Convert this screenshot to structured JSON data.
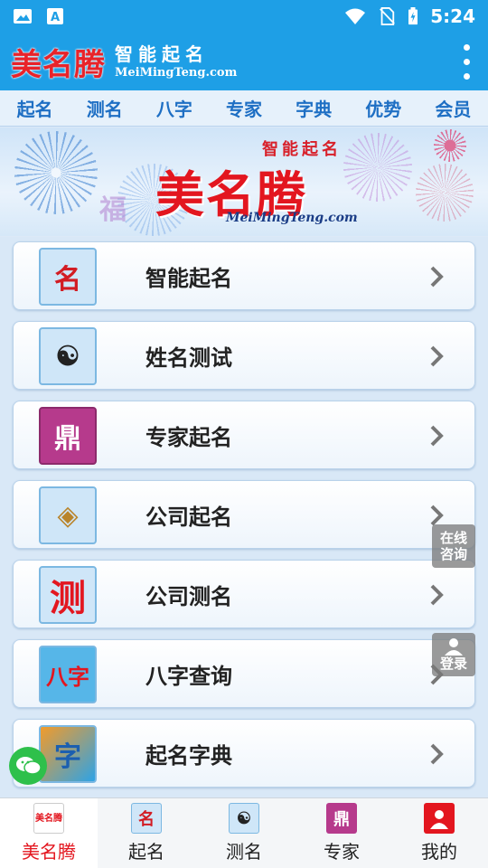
{
  "status_bar": {
    "icons": [
      "image-icon",
      "text-a-icon",
      "wifi-icon",
      "no-sim-icon",
      "battery-charging-icon"
    ],
    "time": "5:24"
  },
  "app_bar": {
    "logo_text": "美名腾",
    "subtitle_cn": "智能起名",
    "subtitle_en": "MeiMingTeng.com"
  },
  "top_nav": {
    "tabs": [
      "起名",
      "测名",
      "八字",
      "专家",
      "字典",
      "优势",
      "会员"
    ]
  },
  "banner": {
    "subtitle": "智能起名",
    "title": "美名腾",
    "url": "MeiMingTeng.com",
    "decor": "福"
  },
  "menu": {
    "items": [
      {
        "label": "智能起名",
        "icon_glyph": "名",
        "icon": "name-magnifier-icon"
      },
      {
        "label": "姓名测试",
        "icon_glyph": "☯",
        "icon": "yinyang-magnifier-icon"
      },
      {
        "label": "专家起名",
        "icon_glyph": "鼎",
        "icon": "expert-seal-icon"
      },
      {
        "label": "公司起名",
        "icon_glyph": "◈",
        "icon": "compass-icon"
      },
      {
        "label": "公司测名",
        "icon_glyph": "测",
        "icon": "test-char-icon"
      },
      {
        "label": "八字查询",
        "icon_glyph": "八字",
        "icon": "bazi-icon"
      },
      {
        "label": "起名字典",
        "icon_glyph": "字",
        "icon": "dictionary-icon"
      }
    ]
  },
  "floating": {
    "online_consult_line1": "在线",
    "online_consult_line2": "咨询",
    "login": "登录",
    "wechat_icon": "wechat-icon"
  },
  "bottom_nav": {
    "items": [
      {
        "label": "美名腾",
        "icon": "home-logo-icon",
        "active": true
      },
      {
        "label": "起名",
        "icon": "name-icon",
        "active": false
      },
      {
        "label": "测名",
        "icon": "test-name-icon",
        "active": false
      },
      {
        "label": "专家",
        "icon": "expert-icon",
        "active": false
      },
      {
        "label": "我的",
        "icon": "profile-icon",
        "active": false
      }
    ]
  },
  "colors": {
    "primary": "#1e9fe6",
    "accent_red": "#e3161f",
    "nav_text": "#1e6fc4"
  }
}
